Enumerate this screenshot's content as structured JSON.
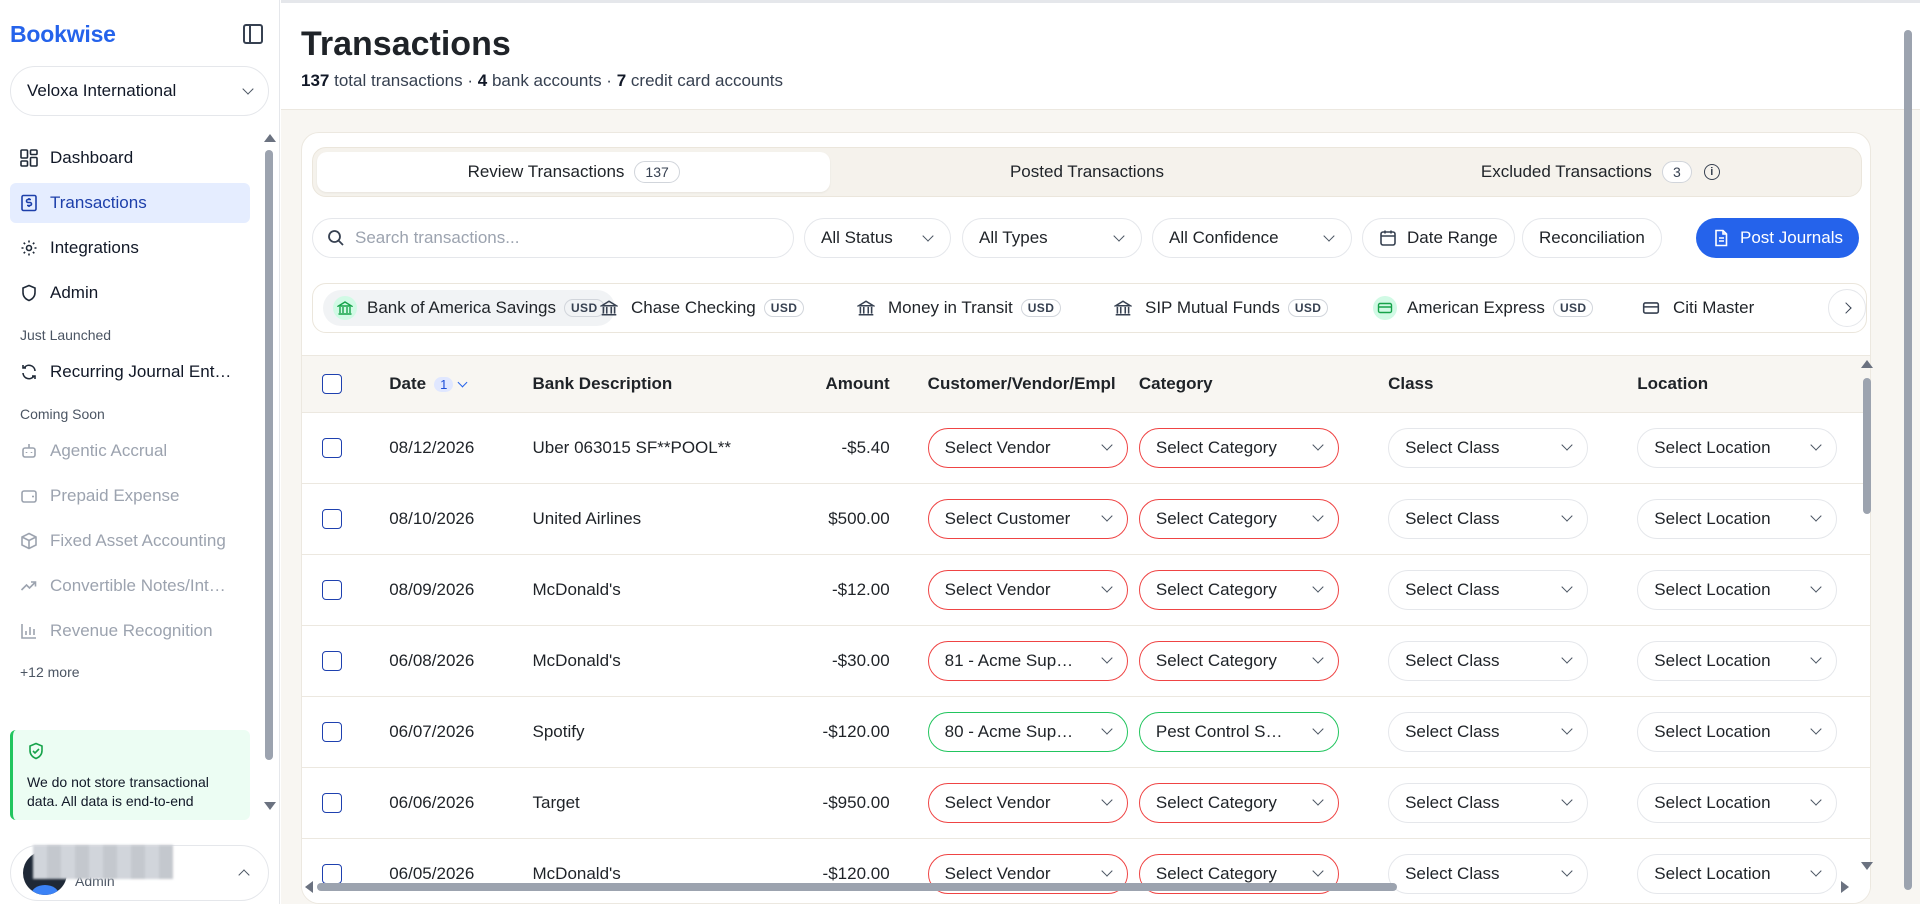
{
  "sidebar": {
    "brand": "Bookwise",
    "org": "Veloxa International",
    "nav": [
      {
        "label": "Dashboard"
      },
      {
        "label": "Transactions"
      },
      {
        "label": "Integrations"
      },
      {
        "label": "Admin"
      }
    ],
    "just_launched_title": "Just Launched",
    "just_launched": [
      {
        "label": "Recurring Journal Ent…"
      }
    ],
    "coming_soon_title": "Coming Soon",
    "coming_soon": [
      {
        "label": "Agentic Accrual"
      },
      {
        "label": "Prepaid Expense"
      },
      {
        "label": "Fixed Asset Accounting"
      },
      {
        "label": "Convertible Notes/Int…"
      },
      {
        "label": "Revenue Recognition"
      }
    ],
    "more": "+12 more",
    "notice": "We do not store transactional data. All data is end-to-end",
    "user_role": "Admin"
  },
  "header": {
    "title": "Transactions",
    "total_count": "137",
    "total_label": "total transactions ·",
    "bank_count": "4",
    "bank_label": "bank accounts ·",
    "cc_count": "7",
    "cc_label": "credit card accounts"
  },
  "tabs": [
    {
      "label": "Review Transactions",
      "count": "137"
    },
    {
      "label": "Posted Transactions"
    },
    {
      "label": "Excluded Transactions",
      "count": "3"
    }
  ],
  "filters": {
    "search_placeholder": "Search transactions...",
    "status": "All Status",
    "types": "All Types",
    "confidence": "All Confidence",
    "date_range": "Date Range",
    "reconciliation": "Reconciliation",
    "post_journals": "Post Journals"
  },
  "accounts": [
    {
      "name": "Bank of America Savings",
      "currency": "USD"
    },
    {
      "name": "Chase Checking",
      "currency": "USD"
    },
    {
      "name": "Money in Transit",
      "currency": "USD"
    },
    {
      "name": "SIP Mutual Funds",
      "currency": "USD"
    },
    {
      "name": "American Express",
      "currency": "USD"
    },
    {
      "name": "Citi Master"
    }
  ],
  "table": {
    "headers": {
      "date": "Date",
      "sort_badge": "1",
      "desc": "Bank Description",
      "amount": "Amount",
      "cust": "Customer/Vendor/Empl",
      "category": "Category",
      "class": "Class",
      "location": "Location"
    },
    "rows": [
      {
        "date": "08/12/2026",
        "desc": "Uber 063015 SF**POOL**",
        "amount": "-$5.40",
        "cust": "Select Vendor",
        "category": "Select Category",
        "class": "Select Class",
        "location": "Select Location"
      },
      {
        "date": "08/10/2026",
        "desc": "United Airlines",
        "amount": "$500.00",
        "cust": "Select Customer",
        "category": "Select Category",
        "class": "Select Class",
        "location": "Select Location"
      },
      {
        "date": "08/09/2026",
        "desc": "McDonald's",
        "amount": "-$12.00",
        "cust": "Select Vendor",
        "category": "Select Category",
        "class": "Select Class",
        "location": "Select Location"
      },
      {
        "date": "06/08/2026",
        "desc": "McDonald's",
        "amount": "-$30.00",
        "cust": "81 - Acme Sup…",
        "category": "Select Category",
        "class": "Select Class",
        "location": "Select Location"
      },
      {
        "date": "06/07/2026",
        "desc": "Spotify",
        "amount": "-$120.00",
        "cust": "80 - Acme Sup…",
        "category": "Pest Control S…",
        "class": "Select Class",
        "location": "Select Location"
      },
      {
        "date": "06/06/2026",
        "desc": "Target",
        "amount": "-$950.00",
        "cust": "Select Vendor",
        "category": "Select Category",
        "class": "Select Class",
        "location": "Select Location"
      },
      {
        "date": "06/05/2026",
        "desc": "McDonald's",
        "amount": "-$120.00",
        "cust": "Select Vendor",
        "category": "Select Category",
        "class": "Select Class",
        "location": "Select Location"
      }
    ]
  },
  "colors": {
    "brand": "#2563eb",
    "error_border": "#ef4444",
    "ok_border": "#22c55e",
    "active_nav_bg": "#e5edff"
  }
}
